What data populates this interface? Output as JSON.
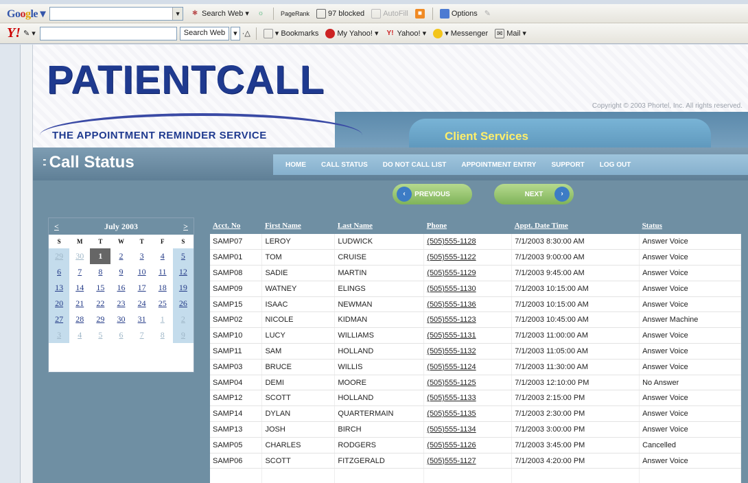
{
  "browser": {
    "google_bar": {
      "search_label": "Search Web",
      "pagerank_label": "PageRank",
      "blocked_label": "97 blocked",
      "autofill_label": "AutoFill",
      "options_label": "Options"
    },
    "yahoo_bar": {
      "search_label": "Search Web",
      "search_value": "",
      "bookmarks_label": "Bookmarks",
      "myyahoo_label": "My Yahoo!",
      "yahoo_label": "Yahoo!",
      "messenger_label": "Messenger",
      "mail_label": "Mail"
    }
  },
  "header": {
    "logo": "PATIENTCALL",
    "tagline": "THE APPOINTMENT REMINDER SERVICE",
    "copyright": "Copyright © 2003 Phortel, Inc. All rights reserved.",
    "section": "Client Services",
    "page_title": "Call Status"
  },
  "nav": [
    "HOME",
    "CALL STATUS",
    "DO NOT CALL LIST",
    "APPOINTMENT ENTRY",
    "SUPPORT",
    "LOG OUT"
  ],
  "pager": {
    "prev": "PREVIOUS",
    "next": "NEXT"
  },
  "calendar": {
    "prev": "<",
    "next": ">",
    "month": "July 2003",
    "dow": [
      "S",
      "M",
      "T",
      "W",
      "T",
      "F",
      "S"
    ],
    "weeks": [
      [
        "29",
        "30",
        "1",
        "2",
        "3",
        "4",
        "5"
      ],
      [
        "6",
        "7",
        "8",
        "9",
        "10",
        "11",
        "12"
      ],
      [
        "13",
        "14",
        "15",
        "16",
        "17",
        "18",
        "19"
      ],
      [
        "20",
        "21",
        "22",
        "23",
        "24",
        "25",
        "26"
      ],
      [
        "27",
        "28",
        "29",
        "30",
        "31",
        "1",
        "2"
      ],
      [
        "3",
        "4",
        "5",
        "6",
        "7",
        "8",
        "9"
      ]
    ],
    "selected_day": "1"
  },
  "table": {
    "headers": [
      "Acct. No",
      "First Name",
      "Last Name",
      "Phone",
      "Appt. Date Time",
      "Status"
    ],
    "rows": [
      [
        "SAMP07",
        "LEROY",
        "LUDWICK",
        "(505)555-1128",
        "7/1/2003 8:30:00 AM",
        "Answer Voice"
      ],
      [
        "SAMP01",
        "TOM",
        "CRUISE",
        "(505)555-1122",
        "7/1/2003 9:00:00 AM",
        "Answer Voice"
      ],
      [
        "SAMP08",
        "SADIE",
        "MARTIN",
        "(505)555-1129",
        "7/1/2003 9:45:00 AM",
        "Answer Voice"
      ],
      [
        "SAMP09",
        "WATNEY",
        "ELINGS",
        "(505)555-1130",
        "7/1/2003 10:15:00 AM",
        "Answer Voice"
      ],
      [
        "SAMP15",
        "ISAAC",
        "NEWMAN",
        "(505)555-1136",
        "7/1/2003 10:15:00 AM",
        "Answer Voice"
      ],
      [
        "SAMP02",
        "NICOLE",
        "KIDMAN",
        "(505)555-1123",
        "7/1/2003 10:45:00 AM",
        "Answer Machine"
      ],
      [
        "SAMP10",
        "LUCY",
        "WILLIAMS",
        "(505)555-1131",
        "7/1/2003 11:00:00 AM",
        "Answer Voice"
      ],
      [
        "SAMP11",
        "SAM",
        "HOLLAND",
        "(505)555-1132",
        "7/1/2003 11:05:00 AM",
        "Answer Voice"
      ],
      [
        "SAMP03",
        "BRUCE",
        "WILLIS",
        "(505)555-1124",
        "7/1/2003 11:30:00 AM",
        "Answer Voice"
      ],
      [
        "SAMP04",
        "DEMI",
        "MOORE",
        "(505)555-1125",
        "7/1/2003 12:10:00 PM",
        "No Answer"
      ],
      [
        "SAMP12",
        "SCOTT",
        "HOLLAND",
        "(505)555-1133",
        "7/1/2003 2:15:00 PM",
        "Answer Voice"
      ],
      [
        "SAMP14",
        "DYLAN",
        "QUARTERMAIN",
        "(505)555-1135",
        "7/1/2003 2:30:00 PM",
        "Answer Voice"
      ],
      [
        "SAMP13",
        "JOSH",
        "BIRCH",
        "(505)555-1134",
        "7/1/2003 3:00:00 PM",
        "Answer Voice"
      ],
      [
        "SAMP05",
        "CHARLES",
        "RODGERS",
        "(505)555-1126",
        "7/1/2003 3:45:00 PM",
        "Cancelled"
      ],
      [
        "SAMP06",
        "SCOTT",
        "FITZGERALD",
        "(505)555-1127",
        "7/1/2003 4:20:00 PM",
        "Answer Voice"
      ]
    ]
  }
}
